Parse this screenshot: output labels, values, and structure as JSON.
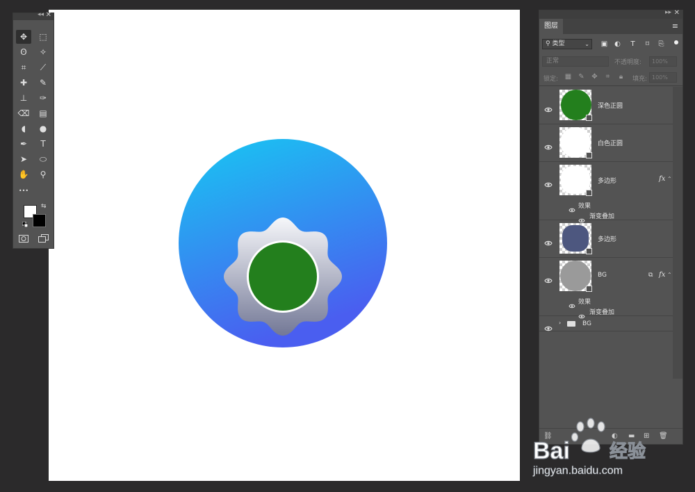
{
  "canvas": {
    "background": "#ffffff",
    "circle_gradient": [
      "#17c8f2",
      "#3f6ef0"
    ],
    "badge_gradient": [
      "#f4f5f8",
      "#7a7f99"
    ],
    "inner_white": "#ffffff",
    "inner_green": "#237f1d"
  },
  "toolbar": {
    "tools": [
      {
        "icon": "move-tool-icon",
        "glyph": "✥"
      },
      {
        "icon": "marquee-tool-icon",
        "glyph": "⬚"
      },
      {
        "icon": "lasso-tool-icon",
        "glyph": "ʘ"
      },
      {
        "icon": "magic-wand-icon",
        "glyph": "✧"
      },
      {
        "icon": "crop-tool-icon",
        "glyph": "⌗"
      },
      {
        "icon": "eyedropper-icon",
        "glyph": "⟋"
      },
      {
        "icon": "healing-brush-icon",
        "glyph": "✚"
      },
      {
        "icon": "brush-tool-icon",
        "glyph": "✎"
      },
      {
        "icon": "stamp-tool-icon",
        "glyph": "⊥"
      },
      {
        "icon": "history-brush-icon",
        "glyph": "✑"
      },
      {
        "icon": "eraser-tool-icon",
        "glyph": "⌫"
      },
      {
        "icon": "gradient-tool-icon",
        "glyph": "▤"
      },
      {
        "icon": "blur-tool-icon",
        "glyph": "◖"
      },
      {
        "icon": "dodge-tool-icon",
        "glyph": "●"
      },
      {
        "icon": "pen-tool-icon",
        "glyph": "✒"
      },
      {
        "icon": "type-tool-icon",
        "glyph": "T"
      },
      {
        "icon": "path-select-icon",
        "glyph": "➤"
      },
      {
        "icon": "ellipse-tool-icon",
        "glyph": "⬭"
      },
      {
        "icon": "hand-tool-icon",
        "glyph": "✋"
      },
      {
        "icon": "zoom-tool-icon",
        "glyph": "⚲"
      },
      {
        "icon": "more-tools-icon",
        "glyph": "•••"
      }
    ],
    "foreground_color": "#ffffff",
    "background_color": "#000000"
  },
  "layers_panel": {
    "tab_label": "图层",
    "filter_label": "类型",
    "blend_mode": "正常",
    "opacity_label": "不透明度:",
    "opacity_value": "100%",
    "lock_label": "锁定:",
    "fill_label": "填充:",
    "fill_value": "100%",
    "layers": [
      {
        "name": "深色正圆",
        "thumb_color": "#237f1d"
      },
      {
        "name": "白色正圆",
        "thumb_color": "#ffffff"
      },
      {
        "name": "多边形",
        "fx": "fx",
        "effects_label": "效果",
        "effect": "渐变叠加",
        "thumb_color": "#ffffff"
      },
      {
        "name": "多边形",
        "thumb_color": "#4d577f"
      },
      {
        "name": "BG",
        "fx": "fx",
        "effects_label": "效果",
        "effect": "渐变叠加",
        "thumb_color": "#9a9a9a"
      },
      {
        "name": "BG",
        "type": "group"
      }
    ]
  },
  "watermark": {
    "brand": "Bai",
    "brand2": "经验",
    "url": "jingyan.baidu.com"
  }
}
